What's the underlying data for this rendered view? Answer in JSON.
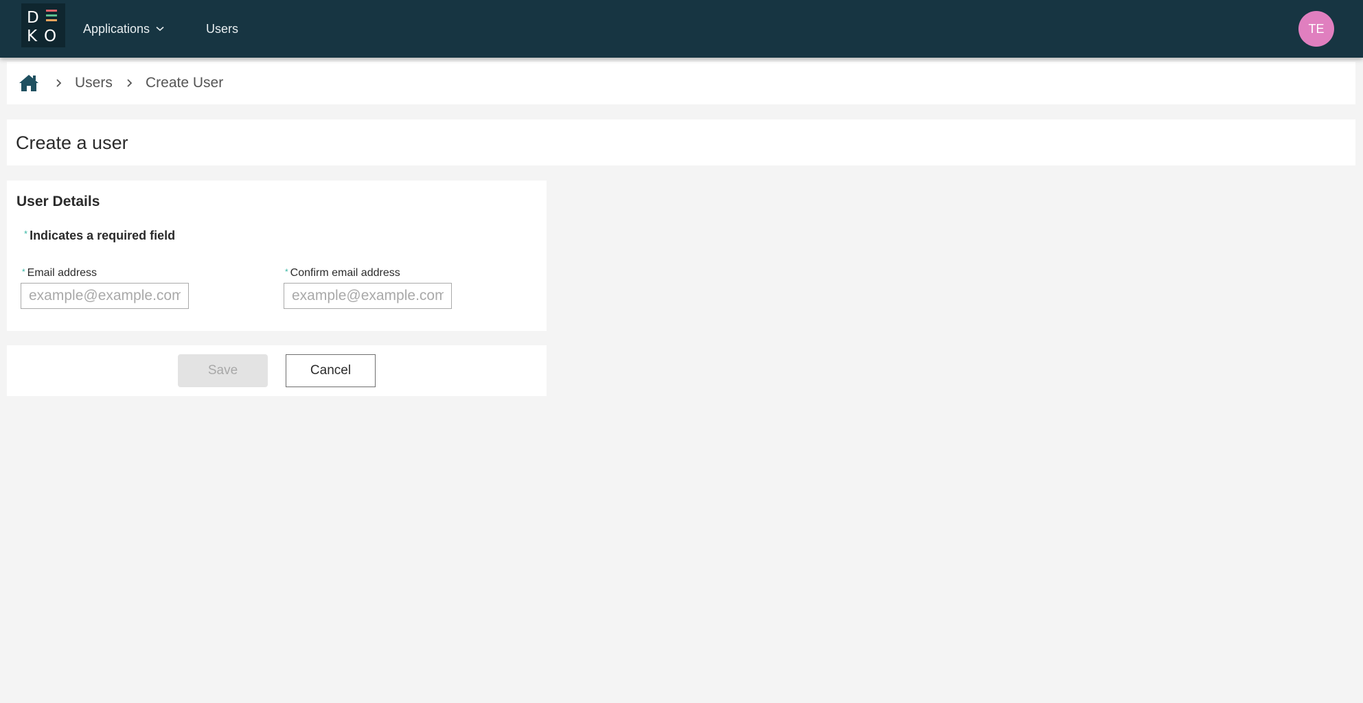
{
  "nav": {
    "logo_letters": [
      "D",
      "K",
      "O"
    ],
    "applications_label": "Applications",
    "users_label": "Users",
    "avatar_initials": "TE"
  },
  "breadcrumb": {
    "items": [
      "Users",
      "Create User"
    ]
  },
  "page": {
    "title": "Create a user"
  },
  "form": {
    "section_title": "User Details",
    "required_asterisk": "*",
    "required_note": "Indicates a required field",
    "email": {
      "label": "Email address",
      "placeholder": "example@example.com",
      "value": ""
    },
    "confirm_email": {
      "label": "Confirm email address",
      "placeholder": "example@example.com",
      "value": ""
    }
  },
  "actions": {
    "save_label": "Save",
    "cancel_label": "Cancel"
  },
  "colors": {
    "nav_background": "#173542",
    "logo_bar_red": "#e8636a",
    "logo_bar_green": "#5fbf8f",
    "logo_bar_orange": "#f0a35c",
    "avatar": "#e07fbf",
    "required_asterisk": "#39b7a4",
    "home_icon": "#1f5060"
  }
}
